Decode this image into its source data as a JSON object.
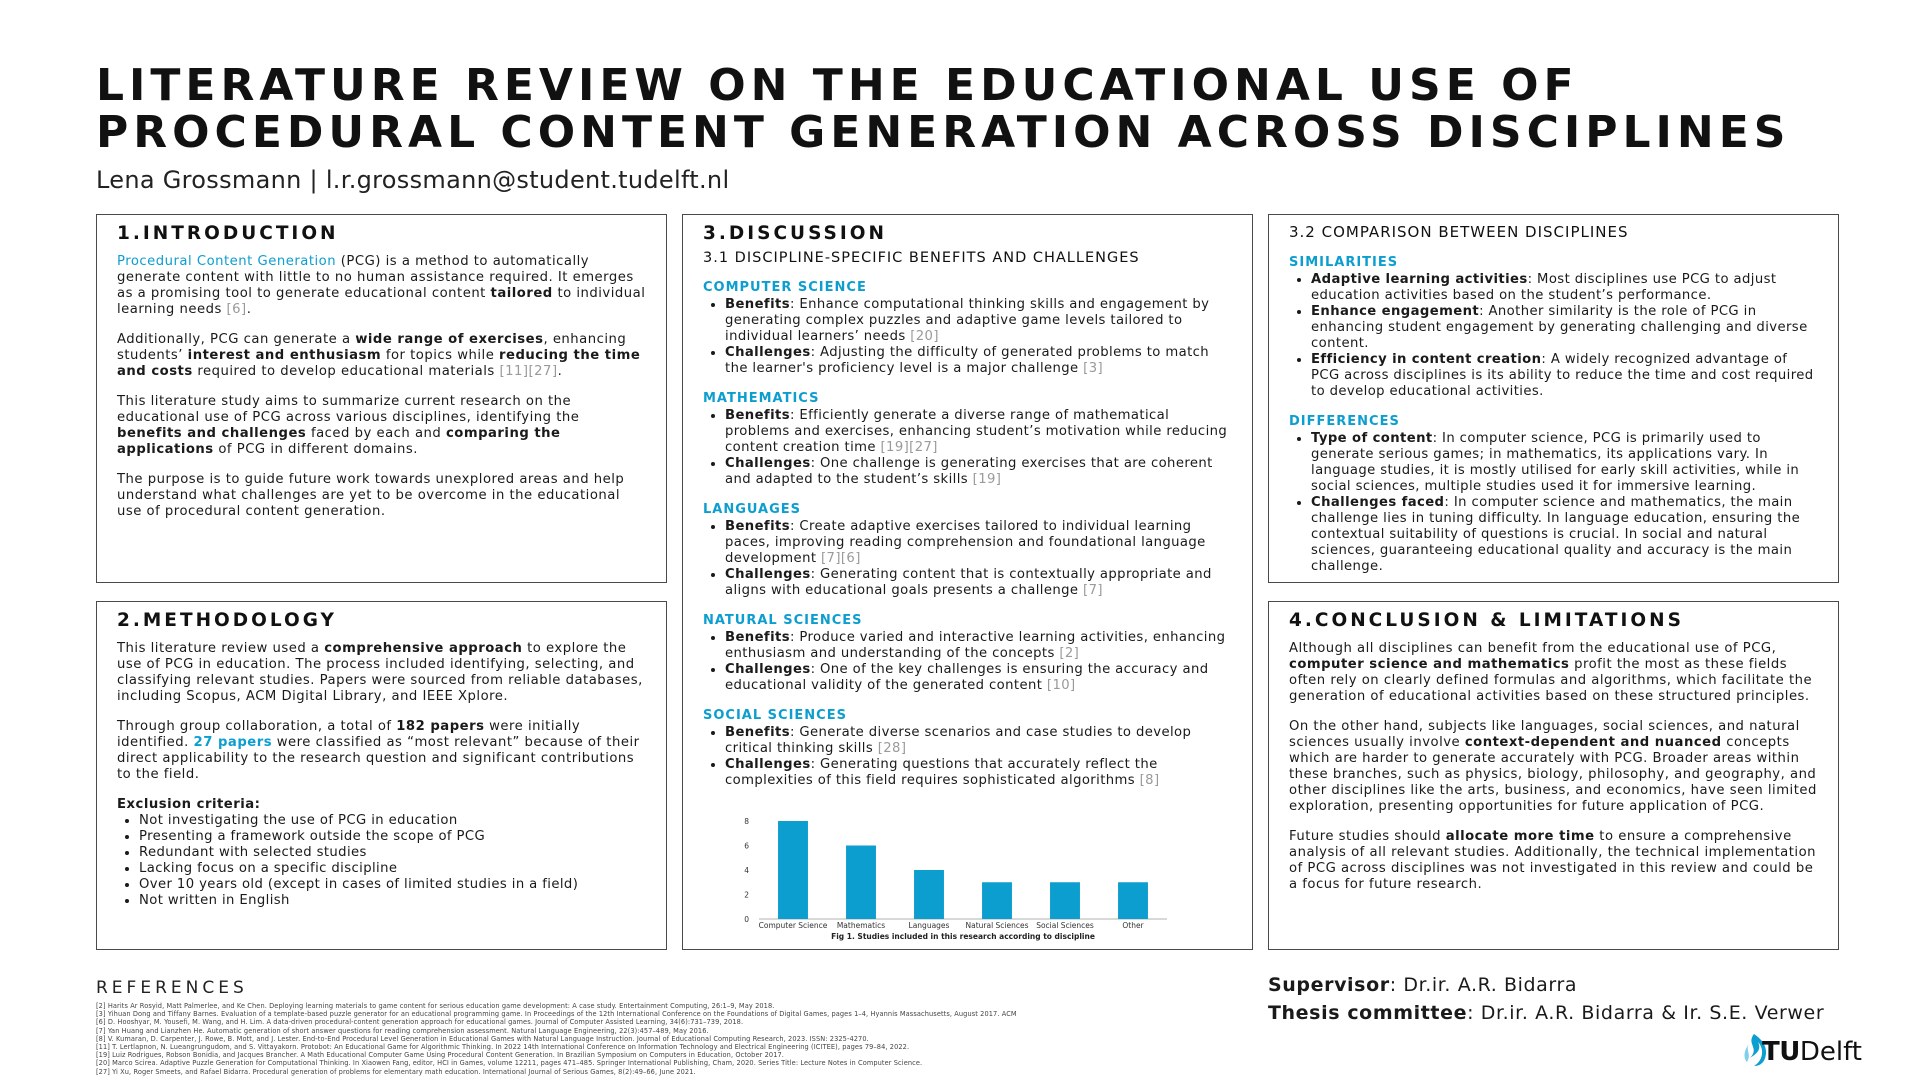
{
  "title_line1": "LITERATURE REVIEW ON THE EDUCATIONAL USE OF",
  "title_line2": "PROCEDURAL CONTENT GENERATION ACROSS DISCIPLINES",
  "author": "Lena Grossmann | l.r.grossmann@student.tudelft.nl",
  "intro": {
    "heading": "1.INTRODUCTION",
    "p1": {
      "hl": "Procedural Content Generation",
      "t1": " (PCG) is a method to automatically generate content with little to no human assistance required. It emerges as a promising tool to generate educational content ",
      "b1": "tailored",
      "t2": " to individual learning needs ",
      "ref": "[6]",
      "t3": "."
    },
    "p2": {
      "t1": "Additionally, PCG can generate a ",
      "b1": "wide range of exercises",
      "t2": ", enhancing students’ ",
      "b2": "interest and enthusiasm",
      "t3": " for topics while ",
      "b3": "reducing the time and costs",
      "t4": " required to develop educational materials ",
      "ref": "[11][27]",
      "t5": "."
    },
    "p3": {
      "t1": "This literature study aims to summarize current research on the educational use of PCG across various disciplines, identifying the ",
      "b1": "benefits and challenges",
      "t2": " faced by each and ",
      "b2": "comparing the applications",
      "t3": " of PCG in different domains."
    },
    "p4": "The purpose is to guide future work towards unexplored areas and help understand what challenges are yet to be overcome in the educational use of procedural content generation."
  },
  "methodology": {
    "heading": "2.METHODOLOGY",
    "p1": {
      "t1": "This literature review used a ",
      "b1": "comprehensive approach",
      "t2": " to explore the use of PCG in education. The process included identifying, selecting, and classifying relevant studies. Papers were sourced from reliable databases, including Scopus, ACM Digital Library, and IEEE Xplore."
    },
    "p2": {
      "t1": "Through group collaboration, a total of ",
      "b1": "182 papers",
      "t2": " were initially identified. ",
      "hl": "27 papers",
      "t3": " were classified as “most relevant” because of their direct applicability to the research question and significant contributions to the field."
    },
    "excl_label": "Exclusion criteria:",
    "exclusions": [
      "Not investigating the use of PCG in education",
      "Presenting a framework outside the scope of PCG",
      "Redundant with selected studies",
      "Lacking focus on a specific discipline",
      "Over 10 years old (except in cases of limited studies in a field)",
      "Not written in English"
    ]
  },
  "discussion": {
    "heading": "3.DISCUSSION",
    "subheading": "3.1 DISCIPLINE-SPECIFIC BENEFITS AND CHALLENGES",
    "benefits_label": "Benefits",
    "challenges_label": "Challenges",
    "disciplines": [
      {
        "name": "COMPUTER SCIENCE",
        "benefit": ": Enhance computational thinking skills and engagement by generating complex puzzles and adaptive game levels tailored to individual learners’ needs ",
        "benefit_ref": "[20]",
        "challenge": ": Adjusting the difficulty of generated problems to match the learner's proficiency level is a major challenge ",
        "challenge_ref": "[3]"
      },
      {
        "name": "MATHEMATICS",
        "benefit": ": Efficiently generate a diverse range of mathematical problems and exercises, enhancing student’s motivation while reducing content creation time ",
        "benefit_ref": "[19][27]",
        "challenge": ": One challenge is generating exercises that are coherent and adapted to the student’s skills ",
        "challenge_ref": "[19]"
      },
      {
        "name": "LANGUAGES",
        "benefit": ": Create adaptive exercises tailored to individual learning paces, improving reading comprehension and foundational language development ",
        "benefit_ref": "[7][6]",
        "challenge": ": Generating content that is contextually appropriate and aligns with educational goals presents a challenge ",
        "challenge_ref": "[7]"
      },
      {
        "name": "NATURAL SCIENCES",
        "benefit": ": Produce varied and interactive learning activities, enhancing enthusiasm and understanding of the concepts ",
        "benefit_ref": "[2]",
        "challenge": ": One of the key challenges is ensuring the accuracy and educational validity of the generated content ",
        "challenge_ref": "[10]"
      },
      {
        "name": "SOCIAL SCIENCES",
        "benefit": ": Generate diverse scenarios and case studies to develop critical thinking skills ",
        "benefit_ref": "[28]",
        "challenge": ": Generating questions that accurately reflect the complexities of this field requires sophisticated algorithms ",
        "challenge_ref": "[8]"
      }
    ]
  },
  "chart_data": {
    "type": "bar",
    "title": "Fig 1. Studies included in this research according to discipline",
    "categories": [
      "Computer Science",
      "Mathematics",
      "Languages",
      "Natural Sciences",
      "Social Sciences",
      "Other"
    ],
    "values": [
      8,
      6,
      4,
      3,
      3,
      3
    ],
    "ylim": [
      0,
      8
    ],
    "yticks": [
      "0",
      "2",
      "4",
      "6",
      "8"
    ],
    "grid": false,
    "bar_color": "#0c9ecf"
  },
  "comparison": {
    "heading": "3.2 COMPARISON BETWEEN DISCIPLINES",
    "sim_label": "SIMILARITIES",
    "similarities": [
      {
        "b": "Adaptive learning activities",
        "t": ": Most disciplines use PCG to adjust education activities based on the student’s performance."
      },
      {
        "b": "Enhance engagement",
        "t": ": Another similarity is the role of PCG in enhancing student engagement by generating challenging and diverse content."
      },
      {
        "b": "Efficiency in content creation",
        "t": ": A widely recognized advantage of PCG across disciplines is its ability to reduce the time and cost required to develop educational activities."
      }
    ],
    "diff_label": "DIFFERENCES",
    "differences": [
      {
        "b": "Type of content",
        "t": ": In computer science, PCG is primarily used to generate serious games; in mathematics, its applications vary. In language studies, it is mostly utilised for early skill activities, while in social sciences, multiple studies used it for immersive learning."
      },
      {
        "b": "Challenges faced",
        "t": ": In computer science and mathematics, the main challenge lies in tuning difficulty. In language education, ensuring the contextual suitability of questions is crucial. In social and natural sciences, guaranteeing educational quality and accuracy is the main challenge."
      }
    ]
  },
  "conclusion": {
    "heading": "4.CONCLUSION & LIMITATIONS",
    "p1": {
      "t1": "Although all disciplines can benefit from the educational use of PCG, ",
      "b1": "computer science and mathematics",
      "t2": " profit the most as these fields often rely on clearly defined formulas and algorithms, which facilitate the generation of educational activities based on these structured principles."
    },
    "p2": {
      "t1": "On the other hand, subjects like languages, social sciences, and natural sciences usually involve ",
      "b1": "context-dependent and nuanced",
      "t2": " concepts which are harder to generate accurately with PCG. Broader areas within these branches, such as physics, biology, philosophy, and geography, and other disciplines like the arts, business, and economics, have seen limited exploration, presenting opportunities for future application of PCG."
    },
    "p3": {
      "t1": "Future studies should ",
      "b1": "allocate more time",
      "t2": " to ensure a comprehensive analysis of all relevant studies. Additionally, the technical implementation of PCG across disciplines was not investigated in this review and could be a focus for future research."
    }
  },
  "references": {
    "heading": "REFERENCES",
    "items": [
      "[2] Harits Ar Rosyid, Matt Palmerlee, and Ke Chen. Deploying learning materials to game content for serious education game development: A case study. Entertainment Computing, 26:1–9, May 2018.",
      "[3] Yihuan Dong and Tiffany Barnes. Evaluation of a template-based puzzle generator for an educational programming game. In Proceedings of the 12th International Conference on the Foundations of Digital Games, pages 1–4, Hyannis Massachusetts, August 2017. ACM.",
      "[6] D. Hooshyar, M. Yousefi, M. Wang, and H. Lim. A data-driven procedural-content generation approach for educational games. Journal of Computer Assisted Learning, 34(6):731–739, 2018.",
      "[7] Yan Huang and Lianzhen He. Automatic generation of short answer questions for reading comprehension assessment. Natural Language Engineering, 22(3):457–489, May 2016.",
      "[8] V. Kumaran, D. Carpenter, J. Rowe, B. Mott, and J. Lester. End-to-End Procedural Level Generation in Educational Games with Natural Language Instruction. Journal of Educational Computing Research, 2023. ISSN: 2325-4270.",
      "[11] T. Lertlapnon, N. Lueangrungudom, and S. Vittayakorn. Protobot: An Educational Game for Algorithmic Thinking. In 2022 14th International Conference on Information Technology and Electrical Engineering (ICITEE), pages 79–84, 2022.",
      "[19] Luiz Rodrigues, Robson Bonidia, and Jacques Brancher. A Math Educational Computer Game Using Procedural Content Generation. In Brazilian Symposium on Computers in Education, October 2017.",
      "[20] Marco Scirea. Adaptive Puzzle Generation for Computational Thinking. In Xiaowen Fang, editor, HCI in Games, volume 12211, pages 471–485. Springer International Publishing, Cham, 2020. Series Title: Lecture Notes in Computer Science.",
      "[27] Yi Xu, Roger Smeets, and Rafael Bidarra. Procedural generation of problems for elementary math education. International Journal of Serious Games, 8(2):49–66, June 2021."
    ]
  },
  "supervisor": {
    "label": "Supervisor",
    "value": ": Dr.ir. A.R. Bidarra"
  },
  "committee": {
    "label": "Thesis committee",
    "value": ": Dr.ir. A.R. Bidarra & Ir. S.E. Verwer"
  },
  "logo": {
    "tu": "TU",
    "delft": "Delft"
  }
}
